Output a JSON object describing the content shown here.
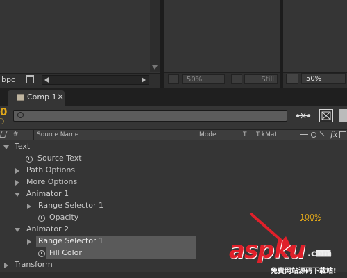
{
  "top_left": {
    "bpc_label": "bpc"
  },
  "top_mid": {
    "zoom": "50%",
    "still_label": "Still"
  },
  "top_right": {
    "zoom": "50%"
  },
  "tab": {
    "label": "Comp 1",
    "close": "×"
  },
  "timeline": {
    "time_digit": "0",
    "search_placeholder": ""
  },
  "columns": {
    "index": "#",
    "source_name": "Source Name",
    "mode": "Mode",
    "t": "T",
    "trkmat": "TrkMat",
    "fx": "fx"
  },
  "layers": [
    {
      "label": "Text",
      "expanded": true
    },
    {
      "label": "Source Text",
      "stopwatch": true
    },
    {
      "label": "Path Options",
      "expanded": false
    },
    {
      "label": "More Options",
      "expanded": false
    },
    {
      "label": "Animator 1",
      "expanded": true
    },
    {
      "label": "Range Selector 1",
      "expanded": false
    },
    {
      "label": "Opacity",
      "stopwatch": true,
      "value": "100%"
    },
    {
      "label": "Animator 2",
      "expanded": true
    },
    {
      "label": "Range Selector 1",
      "expanded": false,
      "selected": true
    },
    {
      "label": "Fill Color",
      "stopwatch": true,
      "selected": true
    },
    {
      "label": "Transform",
      "expanded": false
    }
  ],
  "watermark": {
    "main": "aspku",
    "domain": ".com",
    "sub": "免费网站源码下载站!"
  },
  "colors": {
    "accent_value": "#d9a21b",
    "selection": "#5a5a5a",
    "arrow": "#e0202a"
  }
}
